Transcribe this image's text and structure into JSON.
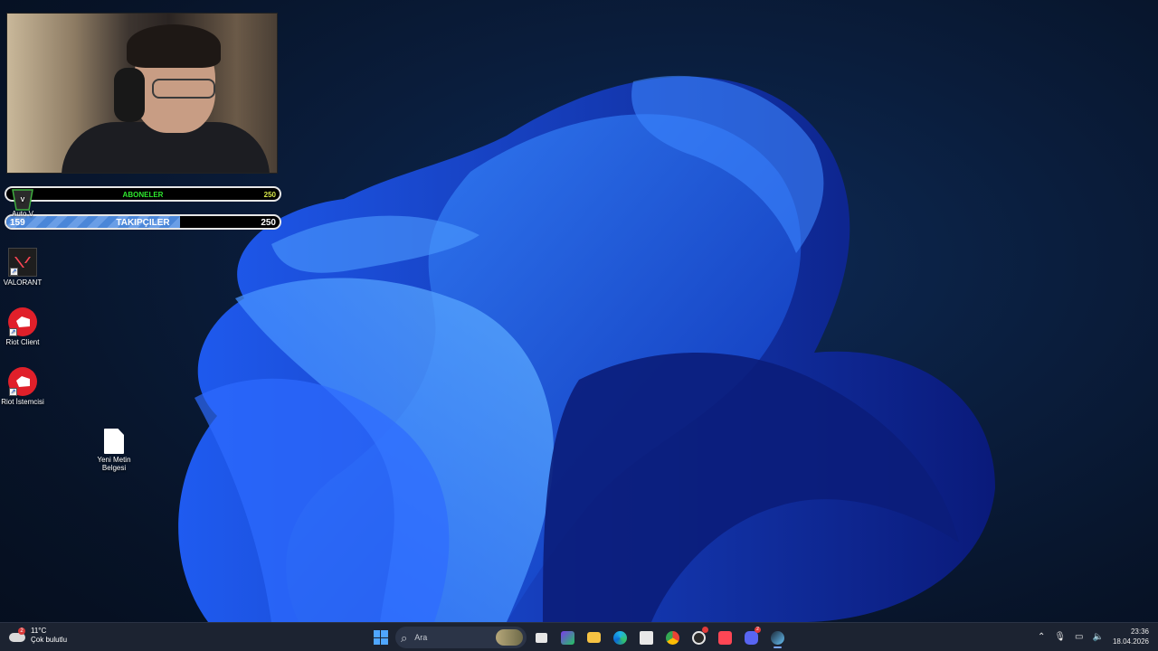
{
  "stream_overlay": {
    "subs_goal": {
      "label": "ABONELER",
      "current": "",
      "target": "250",
      "progress": 0.0
    },
    "followers_goal": {
      "label": "TAKIPÇILER",
      "current": "159",
      "target": "250",
      "progress": 0.636
    }
  },
  "desktop": {
    "icons": [
      {
        "label": "Auto V",
        "icon": "gta-icon"
      },
      {
        "label": "VALORANT",
        "icon": "valorant-icon"
      },
      {
        "label": "Riot Client",
        "icon": "riot-client-icon"
      },
      {
        "label": "Riot İstemcisi",
        "icon": "riot-client-icon"
      },
      {
        "label": "Yeni Metin Belgesi",
        "icon": "text-document-icon"
      }
    ]
  },
  "taskbar": {
    "weather": {
      "temp": "11°C",
      "condition": "Çok bulutlu",
      "badge": "2"
    },
    "search_placeholder": "Ara",
    "apps": [
      "task-view-icon",
      "ms-store-games-icon",
      "file-explorer-icon",
      "edge-icon",
      "microsoft-store-icon",
      "chrome-icon",
      "obs-icon",
      "valorant-icon",
      "discord-icon",
      "steam-icon"
    ],
    "discord_badge": "2",
    "clock": {
      "time": "23:36",
      "date": "18.04.2026"
    }
  }
}
